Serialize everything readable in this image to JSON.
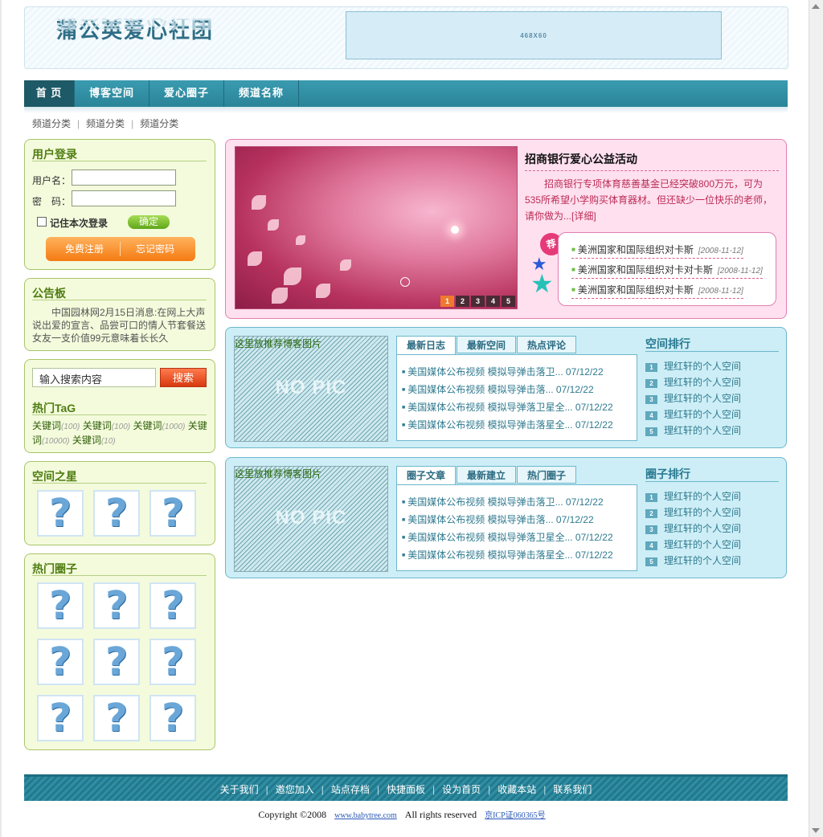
{
  "header": {
    "logo": "蒲公英爱心社团",
    "banner_text": "468X60"
  },
  "nav": {
    "items": [
      "首 页",
      "博客空间",
      "爱心圈子",
      "频道名称"
    ]
  },
  "subnav": {
    "items": [
      "频道分类",
      "频道分类",
      "频道分类"
    ],
    "separator": "|"
  },
  "login": {
    "title": "用户登录",
    "username_label": "用户名：",
    "password_label": "密　码：",
    "remember_label": "记住本次登录",
    "confirm_label": "确定",
    "register_label": "免费注册",
    "forgot_label": "忘记密码"
  },
  "notice": {
    "title": "公告板",
    "text": "中国园林网2月15日消息:在网上大声说出爱的宣言、品尝可口的情人节套餐送女友一支价值99元意味着长长久"
  },
  "search": {
    "input_value": "输入搜索内容",
    "button_label": "搜索",
    "hot_tags_title": "热门TaG",
    "tags": [
      {
        "word": "关键词",
        "count": "(100)"
      },
      {
        "word": "关键词",
        "count": "(100)"
      },
      {
        "word": "关键词",
        "count": "(1000)"
      },
      {
        "word": "关键词",
        "count": "(10000)"
      },
      {
        "word": "关键词",
        "count": "(10)"
      }
    ]
  },
  "stars": {
    "title": "空间之星",
    "placeholder_glyph": "?"
  },
  "circles": {
    "title": "热门圈子",
    "placeholder_glyph": "?"
  },
  "featured": {
    "title": "招商银行爱心公益活动",
    "text": "招商银行专项体育慈善基金已经突破800万元，可为535所希望小学购买体育器材。但还缺少一位快乐的老师，请你做为...",
    "detail_link": "[详细]",
    "badge": "荐",
    "pager": [
      "1",
      "2",
      "3",
      "4",
      "5"
    ],
    "items": [
      {
        "title": "美洲国家和国际组织对卡斯",
        "date": "[2008-11-12]"
      },
      {
        "title": "美洲国家和国际组织对卡对卡斯",
        "date": "[2008-11-12]"
      },
      {
        "title": "美洲国家和国际组织对卡斯",
        "date": "[2008-11-12]"
      }
    ]
  },
  "blog_panel": {
    "image_caption": "这里放推荐博客图片",
    "no_pic": "NO PIC",
    "tabs": [
      "最新日志",
      "最新空间",
      "热点评论"
    ],
    "items": [
      "美国媒体公布视频 模拟导弹击落卫... 07/12/22",
      "美国媒体公布视频 模拟导弹击落... 07/12/22",
      "美国媒体公布视频 模拟导弹落卫星全... 07/12/22",
      "美国媒体公布视频 模拟导弹击落星全... 07/12/22"
    ],
    "rank_title": "空间排行",
    "ranks": [
      "理红轩的个人空间",
      "理红轩的个人空间",
      "理红轩的个人空间",
      "理红轩的个人空间",
      "理红轩的个人空间"
    ]
  },
  "circle_panel": {
    "image_caption": "这里放推荐博客图片",
    "no_pic": "NO PIC",
    "tabs": [
      "圈子文章",
      "最新建立",
      "热门圈子"
    ],
    "items": [
      "美国媒体公布视频 模拟导弹击落卫... 07/12/22",
      "美国媒体公布视频 模拟导弹击落... 07/12/22",
      "美国媒体公布视频 模拟导弹落卫星全... 07/12/22",
      "美国媒体公布视频 模拟导弹击落星全... 07/12/22"
    ],
    "rank_title": "圈子排行",
    "ranks": [
      "理红轩的个人空间",
      "理红轩的个人空间",
      "理红轩的个人空间",
      "理红轩的个人空间",
      "理红轩的个人空间"
    ]
  },
  "footer": {
    "links": [
      "关于我们",
      "邀您加入",
      "站点存档",
      "快捷面板",
      "设为首页",
      "收藏本站",
      "联系我们"
    ],
    "copyright": "Copyright ©2008",
    "site_link": "www.babytree.com",
    "rights": "All rights reserved",
    "icp": "京ICP证060365号"
  },
  "colors": {
    "nav": "#2a8498",
    "login_bg": "#f4fbdc",
    "featured_bg": "#ffe0ef",
    "panel_bg": "#cdeef6",
    "accent_orange": "#f47b12"
  }
}
